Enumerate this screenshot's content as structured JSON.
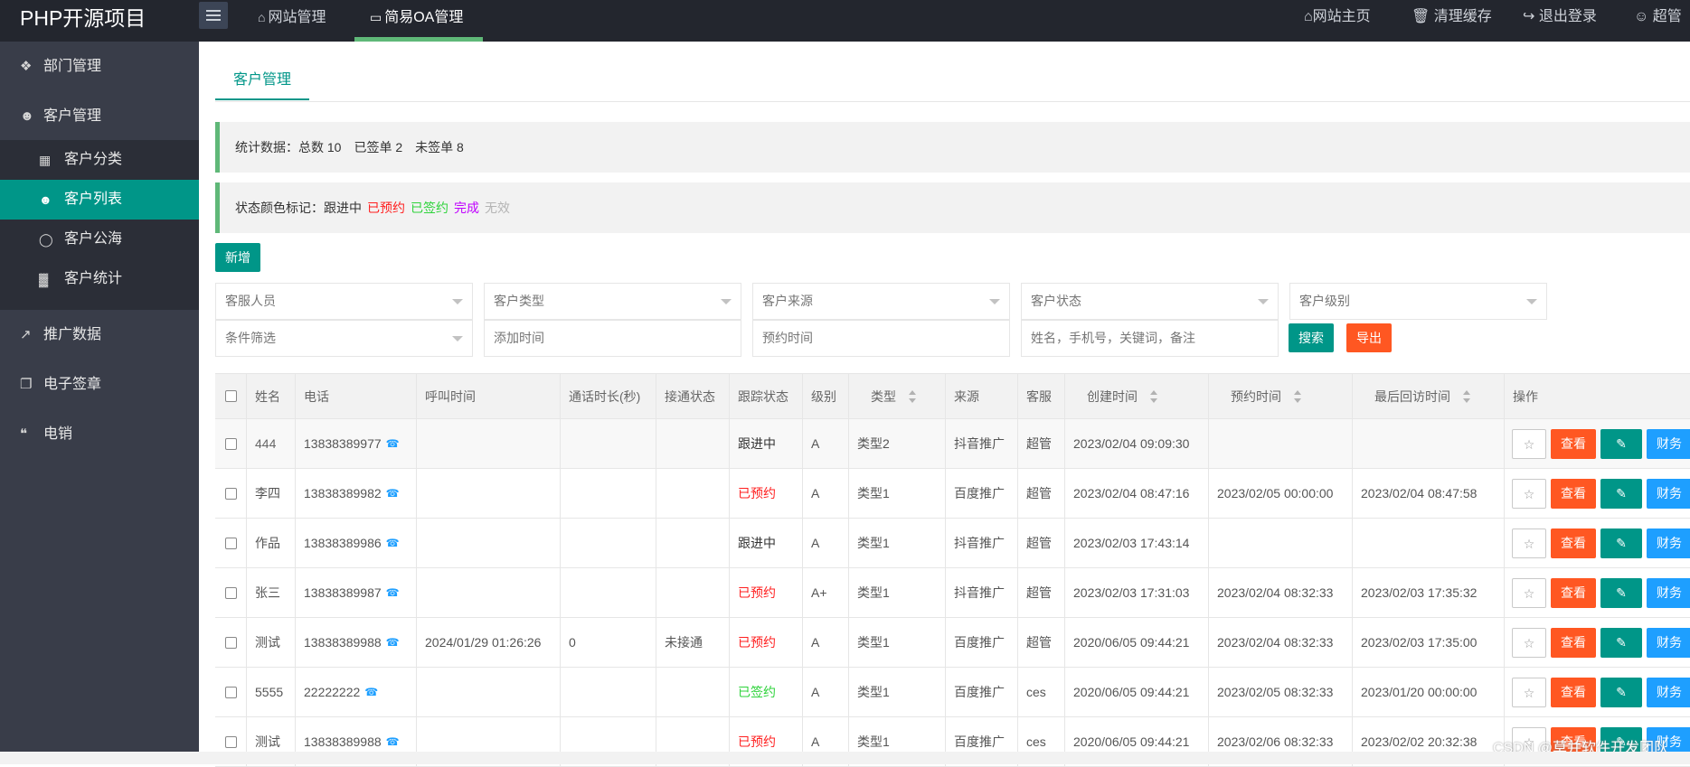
{
  "header": {
    "logo": "PHP开源项目",
    "nav": [
      "网站管理",
      "简易OA管理"
    ],
    "right": [
      "网站主页",
      "清理缓存",
      "退出登录",
      "超管"
    ]
  },
  "sidebar": {
    "items": [
      "部门管理",
      "客户管理",
      "推广数据",
      "电子签章",
      "电销"
    ],
    "sub_items": [
      "客户分类",
      "客户列表",
      "客户公海",
      "客户统计"
    ]
  },
  "page": {
    "tab": "客户管理",
    "stats_label": "统计数据：",
    "stats": [
      "总数 10",
      "已签单 2",
      "未签单 8"
    ],
    "legend_label": "状态颜色标记：",
    "legend": [
      "跟进中",
      "已预约",
      "已签约",
      "完成",
      "无效"
    ],
    "add_button": "新增",
    "search_button": "搜索",
    "export_button": "导出"
  },
  "filters": {
    "service_staff": "客服人员",
    "customer_type": "客户类型",
    "customer_source": "客户来源",
    "customer_status": "客户状态",
    "customer_level": "客户级别",
    "condition": "条件筛选",
    "add_time": "添加时间",
    "appointment_time": "预约时间",
    "keyword": "姓名，手机号，关键词，备注"
  },
  "table": {
    "headers": [
      "姓名",
      "电话",
      "呼叫时间",
      "通话时长(秒)",
      "接通状态",
      "跟踪状态",
      "级别",
      "类型",
      "来源",
      "客服",
      "创建时间",
      "预约时间",
      "最后回访时间",
      "操作"
    ],
    "rows": [
      {
        "name": "444",
        "phone": "13838389977",
        "call_time": "",
        "duration": "",
        "connect": "",
        "status": "跟进中",
        "level": "A",
        "type": "类型2",
        "source": "抖音推广",
        "staff": "超管",
        "created": "2023/02/04 09:09:30",
        "appointment": "",
        "last_visit": ""
      },
      {
        "name": "李四",
        "phone": "13838389982",
        "call_time": "",
        "duration": "",
        "connect": "",
        "status": "已预约",
        "level": "A",
        "type": "类型1",
        "source": "百度推广",
        "staff": "超管",
        "created": "2023/02/04 08:47:16",
        "appointment": "2023/02/05 00:00:00",
        "last_visit": "2023/02/04 08:47:58"
      },
      {
        "name": "作品",
        "phone": "13838389986",
        "call_time": "",
        "duration": "",
        "connect": "",
        "status": "跟进中",
        "level": "A",
        "type": "类型1",
        "source": "抖音推广",
        "staff": "超管",
        "created": "2023/02/03 17:43:14",
        "appointment": "",
        "last_visit": ""
      },
      {
        "name": "张三",
        "phone": "13838389987",
        "call_time": "",
        "duration": "",
        "connect": "",
        "status": "已预约",
        "level": "A+",
        "type": "类型1",
        "source": "抖音推广",
        "staff": "超管",
        "created": "2023/02/03 17:31:03",
        "appointment": "2023/02/04 08:32:33",
        "last_visit": "2023/02/03 17:35:32"
      },
      {
        "name": "测试",
        "phone": "13838389988",
        "call_time": "2024/01/29 01:26:26",
        "duration": "0",
        "connect": "未接通",
        "status": "已预约",
        "level": "A",
        "type": "类型1",
        "source": "百度推广",
        "staff": "超管",
        "created": "2020/06/05 09:44:21",
        "appointment": "2023/02/04 08:32:33",
        "last_visit": "2023/02/03 17:35:00"
      },
      {
        "name": "5555",
        "phone": "22222222",
        "call_time": "",
        "duration": "",
        "connect": "",
        "status": "已签约",
        "level": "A",
        "type": "类型1",
        "source": "百度推广",
        "staff": "ces",
        "created": "2020/06/05 09:44:21",
        "appointment": "2023/02/05 08:32:33",
        "last_visit": "2023/01/20 00:00:00"
      },
      {
        "name": "测试",
        "phone": "13838389988",
        "call_time": "",
        "duration": "",
        "connect": "",
        "status": "已预约",
        "level": "A",
        "type": "类型1",
        "source": "百度推广",
        "staff": "ces",
        "created": "2020/06/05 09:44:21",
        "appointment": "2023/02/06 08:32:33",
        "last_visit": "2023/02/02 20:32:38"
      }
    ],
    "actions": {
      "view": "查看",
      "finance": "财务"
    }
  },
  "status_colors": {
    "跟进中": "#333333",
    "已预约": "#ff1f1f",
    "已签约": "#2ed33b",
    "完成": "#c000ff",
    "无效": "#b4b4b4"
  },
  "watermark": "CSDN @草并软件开发团队"
}
